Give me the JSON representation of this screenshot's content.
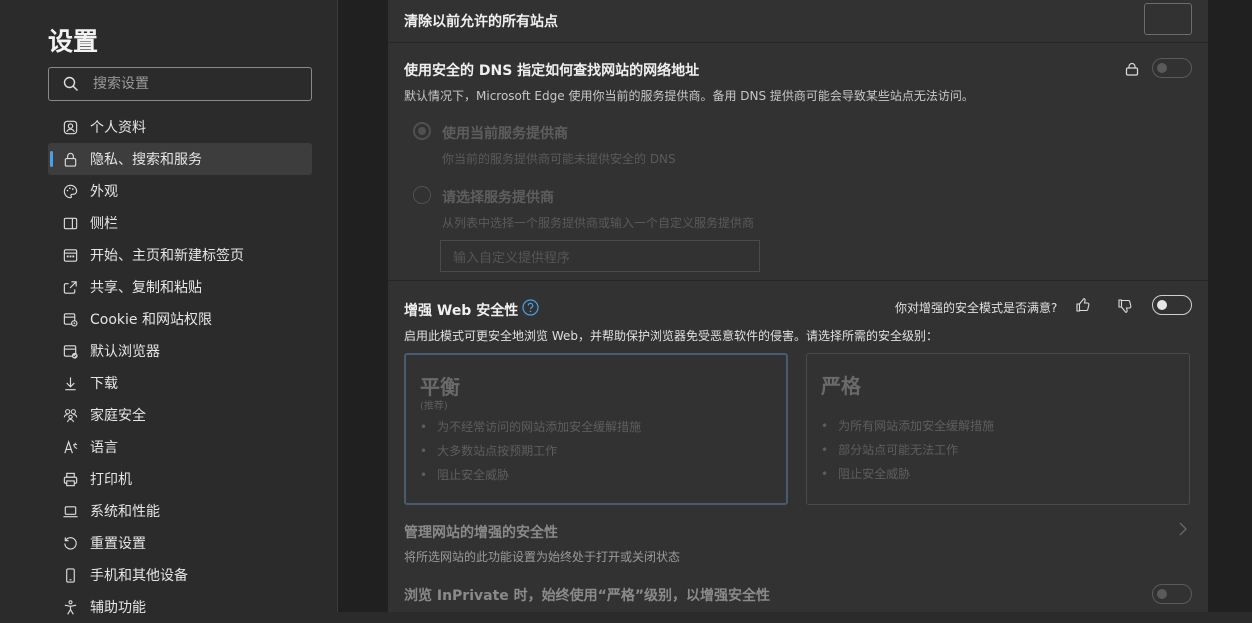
{
  "sidebar": {
    "title": "设置",
    "search_placeholder": "搜索设置",
    "items": [
      {
        "label": "个人资料"
      },
      {
        "label": "隐私、搜索和服务"
      },
      {
        "label": "外观"
      },
      {
        "label": "侧栏"
      },
      {
        "label": "开始、主页和新建标签页"
      },
      {
        "label": "共享、复制和粘贴"
      },
      {
        "label": "Cookie 和网站权限"
      },
      {
        "label": "默认浏览器"
      },
      {
        "label": "下载"
      },
      {
        "label": "家庭安全"
      },
      {
        "label": "语言"
      },
      {
        "label": "打印机"
      },
      {
        "label": "系统和性能"
      },
      {
        "label": "重置设置"
      },
      {
        "label": "手机和其他设备"
      },
      {
        "label": "辅助功能"
      }
    ]
  },
  "clear_sites": {
    "label": "清除以前允许的所有站点"
  },
  "dns": {
    "title": "使用安全的 DNS 指定如何查找网站的网络地址",
    "desc": "默认情况下，Microsoft Edge 使用你当前的服务提供商。备用 DNS 提供商可能会导致某些站点无法访问。",
    "option1_label": "使用当前服务提供商",
    "option1_desc": "你当前的服务提供商可能未提供安全的 DNS",
    "option2_label": "请选择服务提供商",
    "option2_desc": "从列表中选择一个服务提供商或输入一个自定义服务提供商",
    "custom_placeholder": "输入自定义提供程序"
  },
  "enhanced": {
    "title": "增强 Web 安全性",
    "feedback_question": "你对增强的安全模式是否满意?",
    "desc": "启用此模式可更安全地浏览 Web，并帮助保护浏览器免受恶意软件的侵害。请选择所需的安全级别：",
    "balanced": {
      "title": "平衡",
      "sub": "(推荐)",
      "bullets": [
        "为不经常访问的网站添加安全缓解措施",
        "大多数站点按预期工作",
        "阻止安全威胁"
      ]
    },
    "strict": {
      "title": "严格",
      "bullets": [
        "为所有网站添加安全缓解措施",
        "部分站点可能无法工作",
        "阻止安全威胁"
      ]
    },
    "manage_title": "管理网站的增强的安全性",
    "manage_desc": "将所选网站的此功能设置为始终处于打开或关闭状态",
    "inprivate_title": "浏览 InPrivate 时，始终使用“严格”级别，以增强安全性"
  }
}
